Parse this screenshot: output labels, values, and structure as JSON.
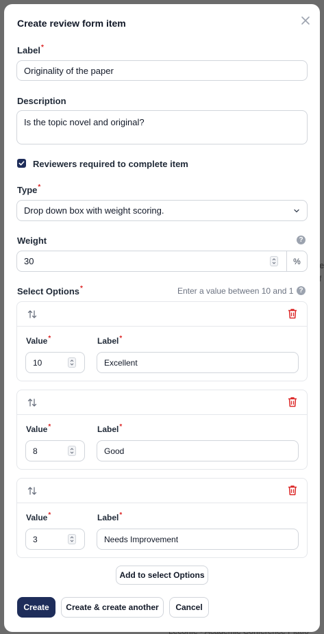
{
  "background": {
    "footer_text": "Leconfe - Academic Conference Platfo",
    "edge_char_1": "e",
    "edge_char_2": "f"
  },
  "modal": {
    "title": "Create review form item",
    "required_marker": "*",
    "label_field": {
      "label": "Label",
      "value": "Originality of the paper"
    },
    "description_field": {
      "label": "Description",
      "value": "Is the topic novel and original?"
    },
    "required_checkbox": {
      "label": "Reviewers required to complete item",
      "checked": true
    },
    "type_field": {
      "label": "Type",
      "value": "Drop down box with weight scoring."
    },
    "weight_field": {
      "label": "Weight",
      "value": "30",
      "suffix": "%"
    },
    "select_options": {
      "label": "Select Options",
      "hint": "Enter a value between 10 and 1",
      "value_label": "Value",
      "label_label": "Label",
      "items": [
        {
          "value": "10",
          "label": "Excellent"
        },
        {
          "value": "8",
          "label": "Good"
        },
        {
          "value": "3",
          "label": "Needs Improvement"
        }
      ],
      "add_button": "Add to select Options"
    },
    "actions": {
      "create": "Create",
      "create_another": "Create & create another",
      "cancel": "Cancel"
    }
  },
  "colors": {
    "primary": "#1e2d5a",
    "danger": "#dc2626",
    "muted_icon": "#9ca3af"
  }
}
